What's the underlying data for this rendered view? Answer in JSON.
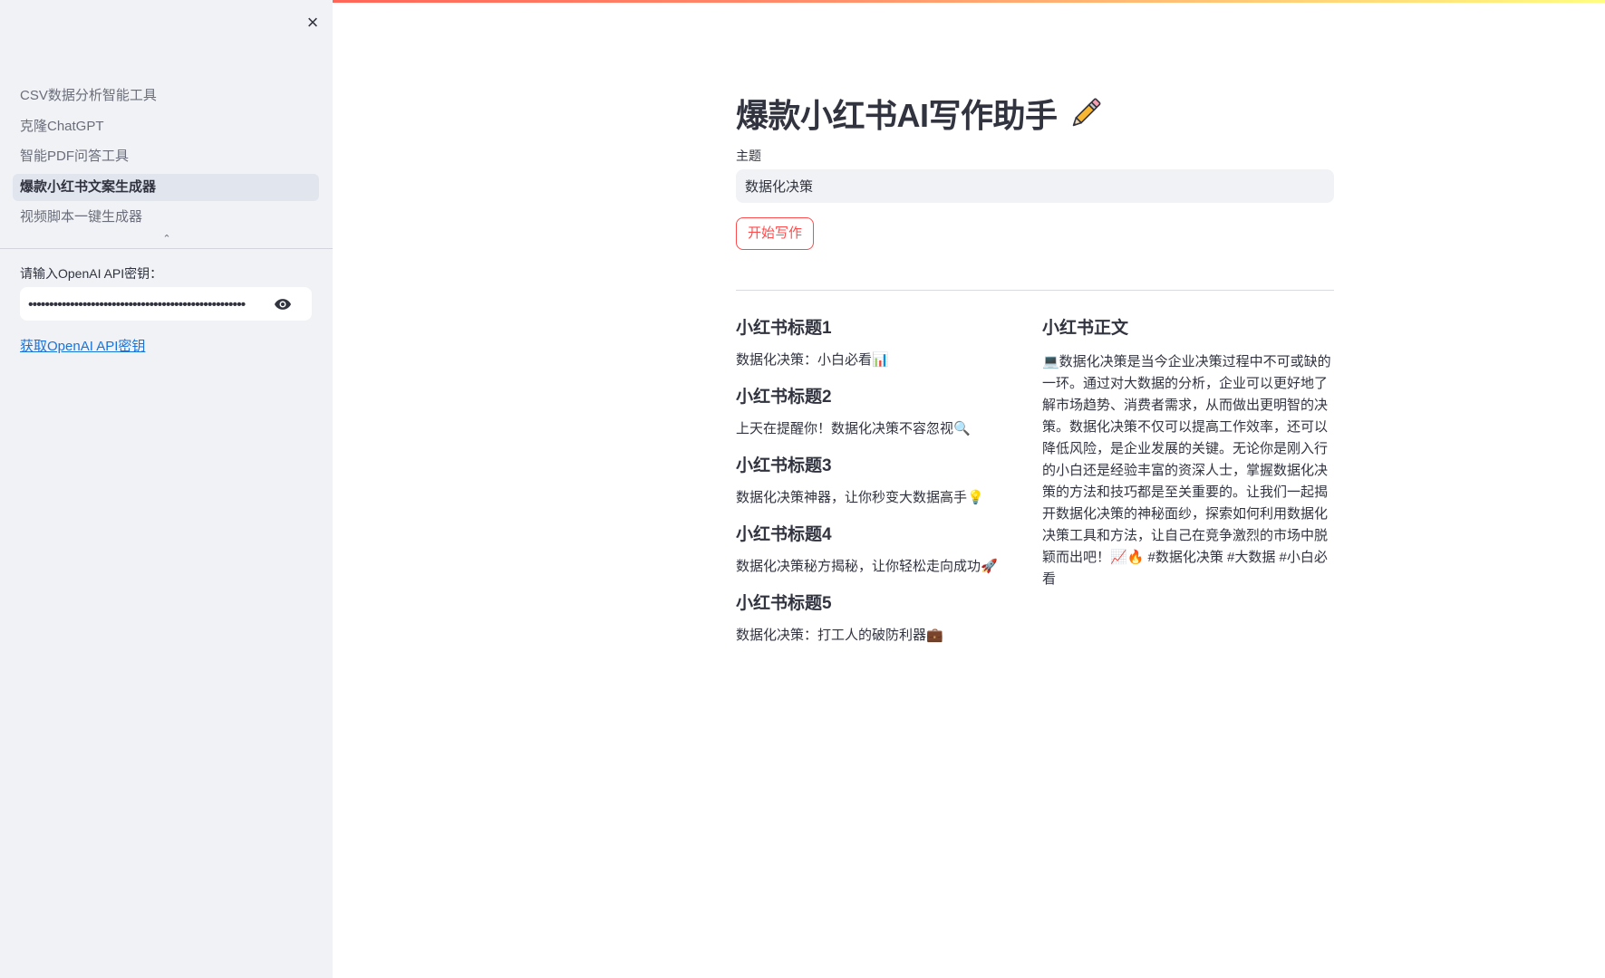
{
  "sidebar": {
    "close_label": "×",
    "nav_items": [
      {
        "label": "CSV数据分析智能工具",
        "active": false
      },
      {
        "label": "克隆ChatGPT",
        "active": false
      },
      {
        "label": "智能PDF问答工具",
        "active": false
      },
      {
        "label": "爆款小红书文案生成器",
        "active": true
      },
      {
        "label": "视频脚本一键生成器",
        "active": false
      }
    ],
    "collapse_label": "⌃",
    "api_key_label": "请输入OpenAI API密钥：",
    "api_key_value": "••••••••••••••••••••••••••••••••••••••••••••••••••••",
    "api_link_label": "获取OpenAI API密钥"
  },
  "main": {
    "title": "爆款小红书AI写作助手",
    "title_icon": "pencil-icon",
    "topic_label": "主题",
    "topic_value": "数据化决策",
    "start_button_label": "开始写作",
    "titles": [
      {
        "heading": "小红书标题1",
        "text": "数据化决策：小白必看📊"
      },
      {
        "heading": "小红书标题2",
        "text": "上天在提醒你！数据化决策不容忽视🔍"
      },
      {
        "heading": "小红书标题3",
        "text": "数据化决策神器，让你秒变大数据高手💡"
      },
      {
        "heading": "小红书标题4",
        "text": "数据化决策秘方揭秘，让你轻松走向成功🚀"
      },
      {
        "heading": "小红书标题5",
        "text": "数据化决策：打工人的破防利器💼"
      }
    ],
    "body_heading": "小红书正文",
    "body_text": "💻数据化决策是当今企业决策过程中不可或缺的一环。通过对大数据的分析，企业可以更好地了解市场趋势、消费者需求，从而做出更明智的决策。数据化决策不仅可以提高工作效率，还可以降低风险，是企业发展的关键。无论你是刚入行的小白还是经验丰富的资深人士，掌握数据化决策的方法和技巧都是至关重要的。让我们一起揭开数据化决策的神秘面纱，探索如何利用数据化决策工具和方法，让自己在竞争激烈的市场中脱颖而出吧！📈🔥 #数据化决策 #大数据 #小白必看"
  },
  "colors": {
    "accent": "#ff4b4b",
    "sidebar_bg": "#f0f2f6",
    "link": "#1a73d9",
    "text": "#31333f"
  }
}
